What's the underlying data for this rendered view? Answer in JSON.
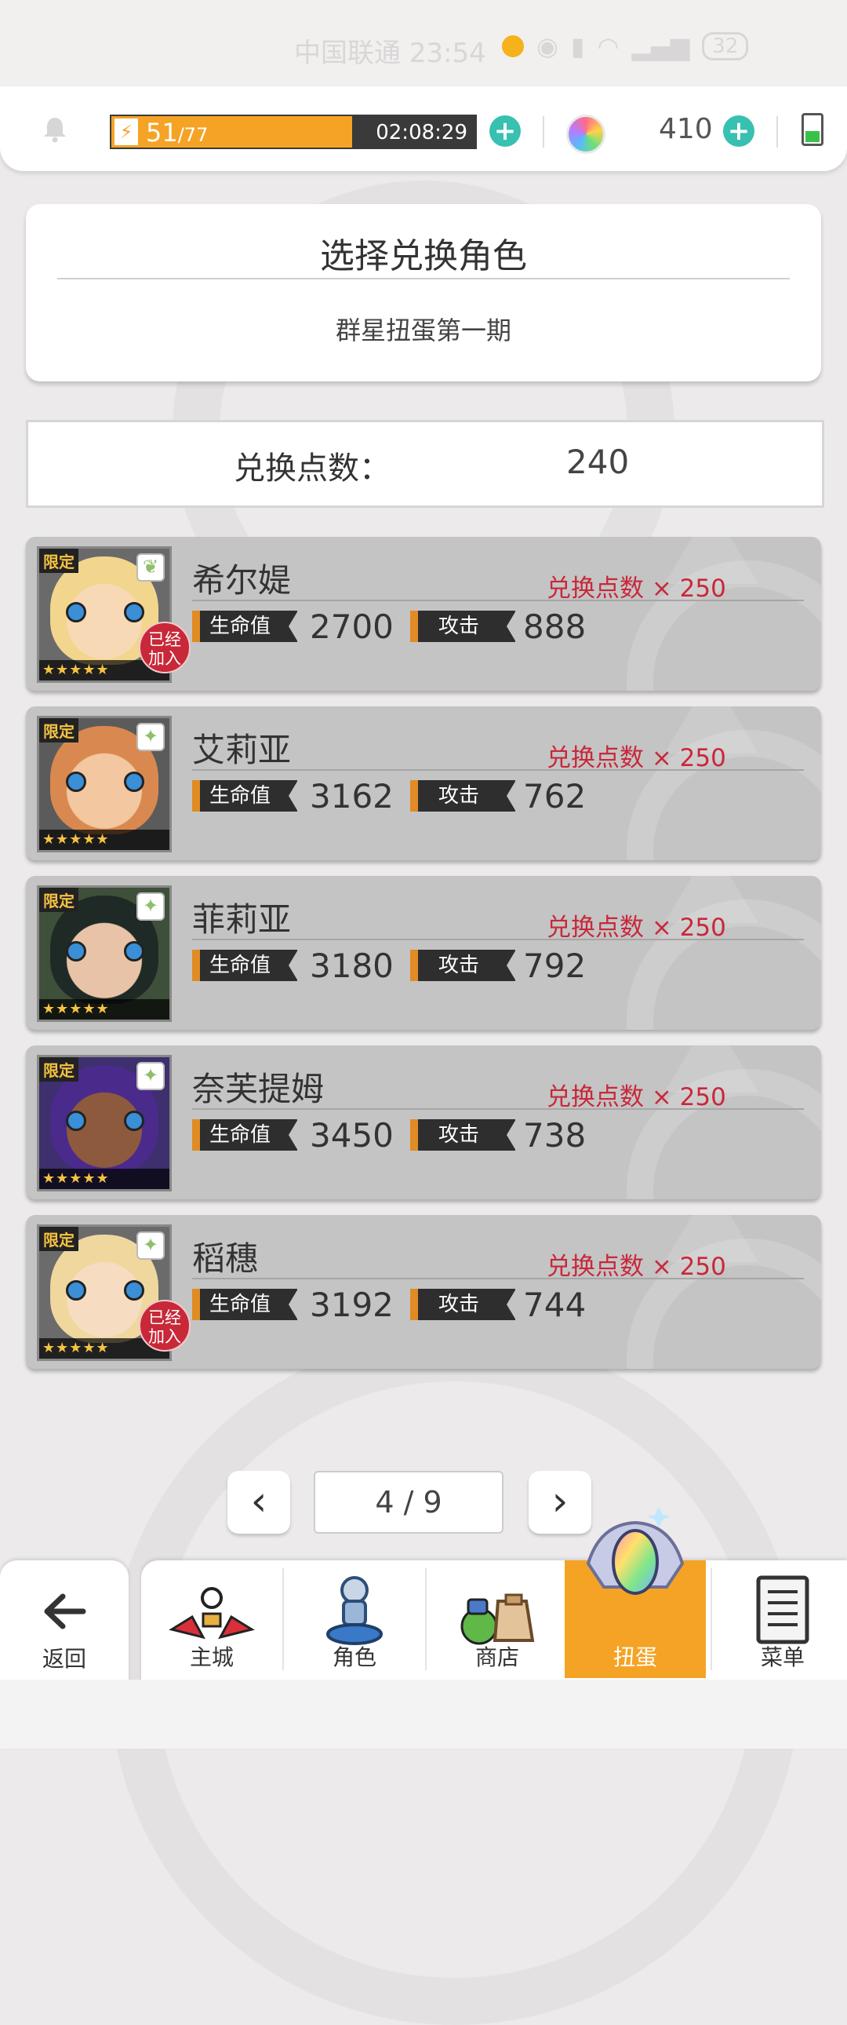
{
  "status_bar": {
    "carrier_time": "中国联通 23:54",
    "battery": "32"
  },
  "topbar": {
    "stamina_value": "51",
    "stamina_max": "/77",
    "stamina_fraction": 0.662,
    "stamina_timer": "02:08:29",
    "gem_count": "410"
  },
  "title_card": {
    "title": "选择兑换角色",
    "subtitle": "群星扭蛋第一期"
  },
  "points": {
    "label": "兑换点数：",
    "value": "240"
  },
  "characters": [
    {
      "name": "希尔媞",
      "cost": "兑换点数 × 250",
      "hp_label": "生命值",
      "hp": "2700",
      "atk_label": "攻击",
      "atk": "888",
      "limited": "限定",
      "stars": "★★★★★",
      "joined": "已经加入",
      "element": "leaf-icon"
    },
    {
      "name": "艾莉亚",
      "cost": "兑换点数 × 250",
      "hp_label": "生命值",
      "hp": "3162",
      "atk_label": "攻击",
      "atk": "762",
      "limited": "限定",
      "stars": "★★★★★",
      "element": "sparkle-icon"
    },
    {
      "name": "菲莉亚",
      "cost": "兑换点数 × 250",
      "hp_label": "生命值",
      "hp": "3180",
      "atk_label": "攻击",
      "atk": "792",
      "limited": "限定",
      "stars": "★★★★★",
      "element": "sparkle-icon"
    },
    {
      "name": "奈芙提姆",
      "cost": "兑换点数 × 250",
      "hp_label": "生命值",
      "hp": "3450",
      "atk_label": "攻击",
      "atk": "738",
      "limited": "限定",
      "stars": "★★★★★",
      "element": "sparkle-icon"
    },
    {
      "name": "稻穗",
      "cost": "兑换点数 × 250",
      "hp_label": "生命值",
      "hp": "3192",
      "atk_label": "攻击",
      "atk": "744",
      "limited": "限定",
      "stars": "★★★★★",
      "joined": "已经加入",
      "element": "sparkle-icon"
    }
  ],
  "pagination": {
    "indicator": "4 / 9"
  },
  "nav": {
    "back": "返回",
    "home": "主城",
    "characters": "角色",
    "shop": "商店",
    "gacha": "扭蛋",
    "menu": "菜单"
  },
  "colors": {
    "accent": "#f5a325",
    "teal": "#38c0b0",
    "cost_red": "#c8283a",
    "joined_red": "#c82838"
  }
}
